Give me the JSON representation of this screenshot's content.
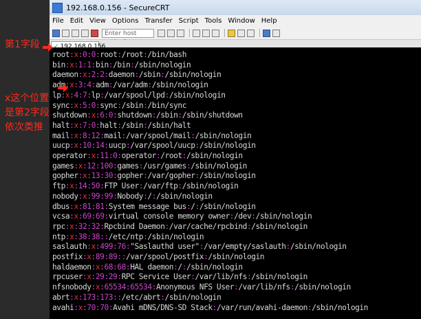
{
  "window": {
    "title": "192.168.0.156 - SecureCRT"
  },
  "menu": [
    "File",
    "Edit",
    "View",
    "Options",
    "Transfer",
    "Script",
    "Tools",
    "Window",
    "Help"
  ],
  "toolbar": {
    "host_placeholder": "Enter host <Alt+R>"
  },
  "tab": {
    "label": "192.168.0.156"
  },
  "annotations": {
    "field1": "第1字段",
    "field2_lines": [
      "x这个位置",
      "是第2字段",
      "依次类推"
    ]
  },
  "colors": {
    "field_text": "#d8d8d8",
    "separator": "#cc44cc",
    "password_x": "#ee3030",
    "annotation": "#ff2a1a"
  },
  "terminal": {
    "lines": [
      [
        "root",
        "x",
        "0",
        "0",
        "root",
        "/root",
        "/bin/bash"
      ],
      [
        "bin",
        "x",
        "1",
        "1",
        "bin",
        "/bin",
        "/sbin/nologin"
      ],
      [
        "daemon",
        "x",
        "2",
        "2",
        "daemon",
        "/sbin",
        "/sbin/nologin"
      ],
      [
        "adm",
        "x",
        "3",
        "4",
        "adm",
        "/var/adm",
        "/sbin/nologin"
      ],
      [
        "lp",
        "x",
        "4",
        "7",
        "lp",
        "/var/spool/lpd",
        "/sbin/nologin"
      ],
      [
        "sync",
        "x",
        "5",
        "0",
        "sync",
        "/sbin",
        "/bin/sync"
      ],
      [
        "shutdown",
        "x",
        "6",
        "0",
        "shutdown",
        "/sbin",
        "/sbin/shutdown"
      ],
      [
        "halt",
        "x",
        "7",
        "0",
        "halt",
        "/sbin",
        "/sbin/halt"
      ],
      [
        "mail",
        "x",
        "8",
        "12",
        "mail",
        "/var/spool/mail",
        "/sbin/nologin"
      ],
      [
        "uucp",
        "x",
        "10",
        "14",
        "uucp",
        "/var/spool/uucp",
        "/sbin/nologin"
      ],
      [
        "operator",
        "x",
        "11",
        "0",
        "operator",
        "/root",
        "/sbin/nologin"
      ],
      [
        "games",
        "x",
        "12",
        "100",
        "games",
        "/usr/games",
        "/sbin/nologin"
      ],
      [
        "gopher",
        "x",
        "13",
        "30",
        "gopher",
        "/var/gopher",
        "/sbin/nologin"
      ],
      [
        "ftp",
        "x",
        "14",
        "50",
        "FTP User",
        "/var/ftp",
        "/sbin/nologin"
      ],
      [
        "nobody",
        "x",
        "99",
        "99",
        "Nobody",
        "/",
        "/sbin/nologin"
      ],
      [
        "dbus",
        "x",
        "81",
        "81",
        "System message bus",
        "/",
        "/sbin/nologin"
      ],
      [
        "vcsa",
        "x",
        "69",
        "69",
        "virtual console memory owner",
        "/dev",
        "/sbin/nologin"
      ],
      [
        "rpc",
        "x",
        "32",
        "32",
        "Rpcbind Daemon",
        "/var/cache/rpcbind",
        "/sbin/nologin"
      ],
      [
        "ntp",
        "x",
        "38",
        "38",
        "",
        "/etc/ntp",
        "/sbin/nologin"
      ],
      [
        "saslauth",
        "x",
        "499",
        "76",
        "\"Saslauthd user\"",
        "/var/empty/saslauth",
        "/sbin/nologin"
      ],
      [
        "postfix",
        "x",
        "89",
        "89",
        "",
        "/var/spool/postfix",
        "/sbin/nologin"
      ],
      [
        "haldaemon",
        "x",
        "68",
        "68",
        "HAL daemon",
        "/",
        "/sbin/nologin"
      ],
      [
        "rpcuser",
        "x",
        "29",
        "29",
        "RPC Service User",
        "/var/lib/nfs",
        "/sbin/nologin"
      ],
      [
        "nfsnobody",
        "x",
        "65534",
        "65534",
        "Anonymous NFS User",
        "/var/lib/nfs",
        "/sbin/nologin"
      ],
      [
        "abrt",
        "x",
        "173",
        "173",
        "",
        "/etc/abrt",
        "/sbin/nologin"
      ],
      [
        "avahi",
        "x",
        "70",
        "70",
        "Avahi mDNS/DNS-SD Stack",
        "/var/run/avahi-daemon",
        "/sbin/nologin"
      ]
    ]
  }
}
